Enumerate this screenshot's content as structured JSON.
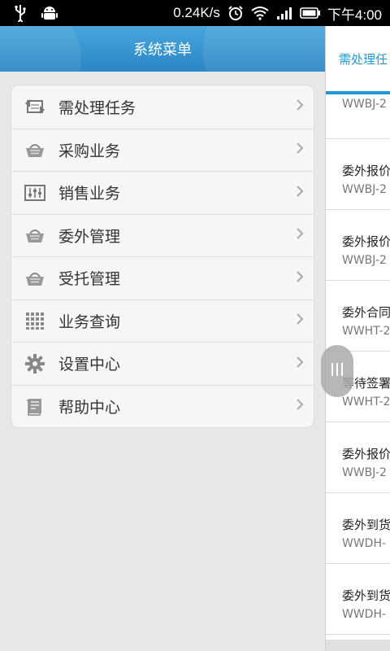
{
  "status_bar": {
    "speed": "0.24K/s",
    "time": "下午4:00",
    "icons": [
      "usb-icon",
      "android-debug-icon",
      "alarm-icon",
      "wifi-icon",
      "signal-icon",
      "battery-icon"
    ]
  },
  "drawer": {
    "title": "系统菜单",
    "items": [
      {
        "label": "需处理任务",
        "icon": "sync-task-icon"
      },
      {
        "label": "采购业务",
        "icon": "basket-icon"
      },
      {
        "label": "销售业务",
        "icon": "equalizer-icon"
      },
      {
        "label": "委外管理",
        "icon": "basket-icon"
      },
      {
        "label": "受托管理",
        "icon": "basket-icon"
      },
      {
        "label": "业务查询",
        "icon": "grid-icon"
      },
      {
        "label": "设置中心",
        "icon": "gear-icon"
      },
      {
        "label": "帮助中心",
        "icon": "document-icon"
      }
    ]
  },
  "content": {
    "tab_label": "需处理任",
    "rows": [
      {
        "title": "",
        "code": "WWBJ-2"
      },
      {
        "title": "委外报价",
        "code": "WWBJ-2"
      },
      {
        "title": "委外报价",
        "code": "WWBJ-2"
      },
      {
        "title": "委外合同",
        "code": "WWHT-2"
      },
      {
        "title": "等待签署",
        "code": "WWHT-2"
      },
      {
        "title": "委外报价",
        "code": "WWBJ-2"
      },
      {
        "title": "委外到货",
        "code": "WWDH-"
      },
      {
        "title": "委外到货",
        "code": "WWDH-"
      }
    ]
  },
  "colors": {
    "accent": "#1e9bd7",
    "header_top": "#49a6dc",
    "header_bottom": "#2a86c4"
  }
}
